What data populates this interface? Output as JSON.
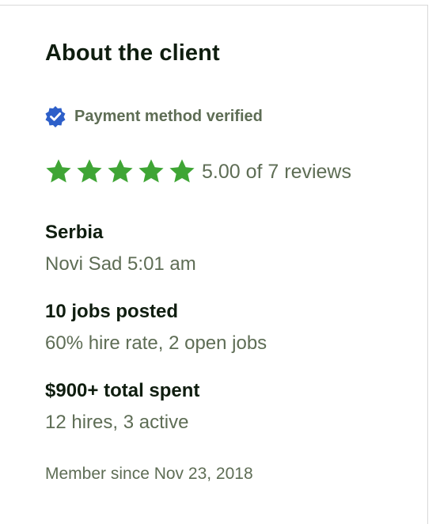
{
  "panel": {
    "title": "About the client",
    "payment_verified_label": "Payment method verified",
    "rating": {
      "stars_filled": 5,
      "stars_total": 5,
      "text": "5.00 of 7 reviews"
    },
    "location": {
      "country": "Serbia",
      "city_time": "Novi Sad 5:01 am"
    },
    "jobs": {
      "posted": "10 jobs posted",
      "details": "60% hire rate, 2 open jobs"
    },
    "spending": {
      "total": "$900+ total spent",
      "details": "12 hires, 3 active"
    },
    "member_since": "Member since Nov 23, 2018"
  },
  "colors": {
    "star": "#3fa535",
    "verified_badge": "#2d5fc9",
    "heading_text": "#0f1d0f",
    "muted_text": "#5e6d55"
  },
  "icons": {
    "verified": "verified-badge-icon",
    "star": "star-icon"
  }
}
